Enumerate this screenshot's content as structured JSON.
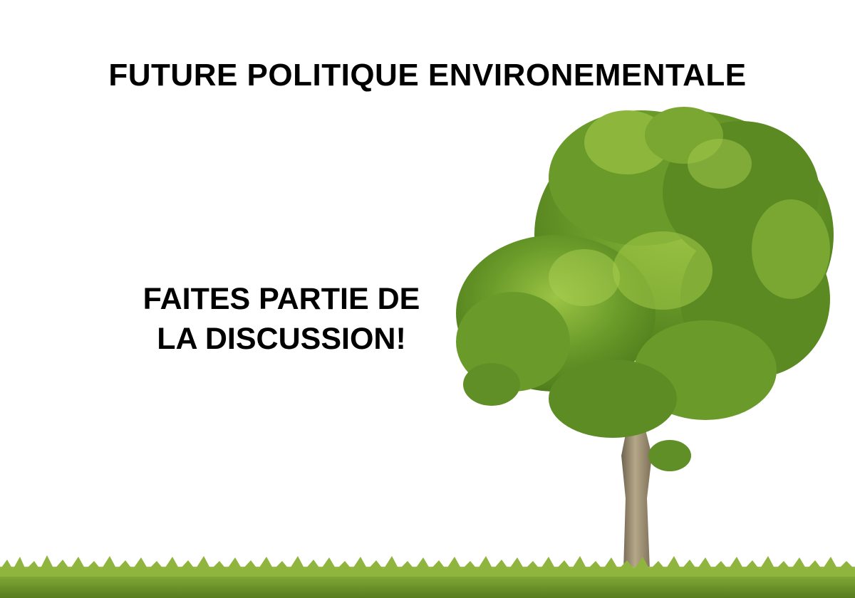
{
  "poster": {
    "title": "FUTURE POLITIQUE ENVIRONEMENTALE",
    "callout_line1": "FAITES PARTIE DE",
    "callout_line2": "LA DISCUSSION!"
  },
  "scene": {
    "tree": "deciduous-tree-icon",
    "ground": "grass-strip",
    "colors": {
      "background": "#ffffff",
      "foliage_dark": "#4f7d1c",
      "foliage_mid": "#6a9b2a",
      "foliage_light": "#9cc445",
      "trunk": "#8a7b62",
      "grass": "#7aa232"
    }
  }
}
